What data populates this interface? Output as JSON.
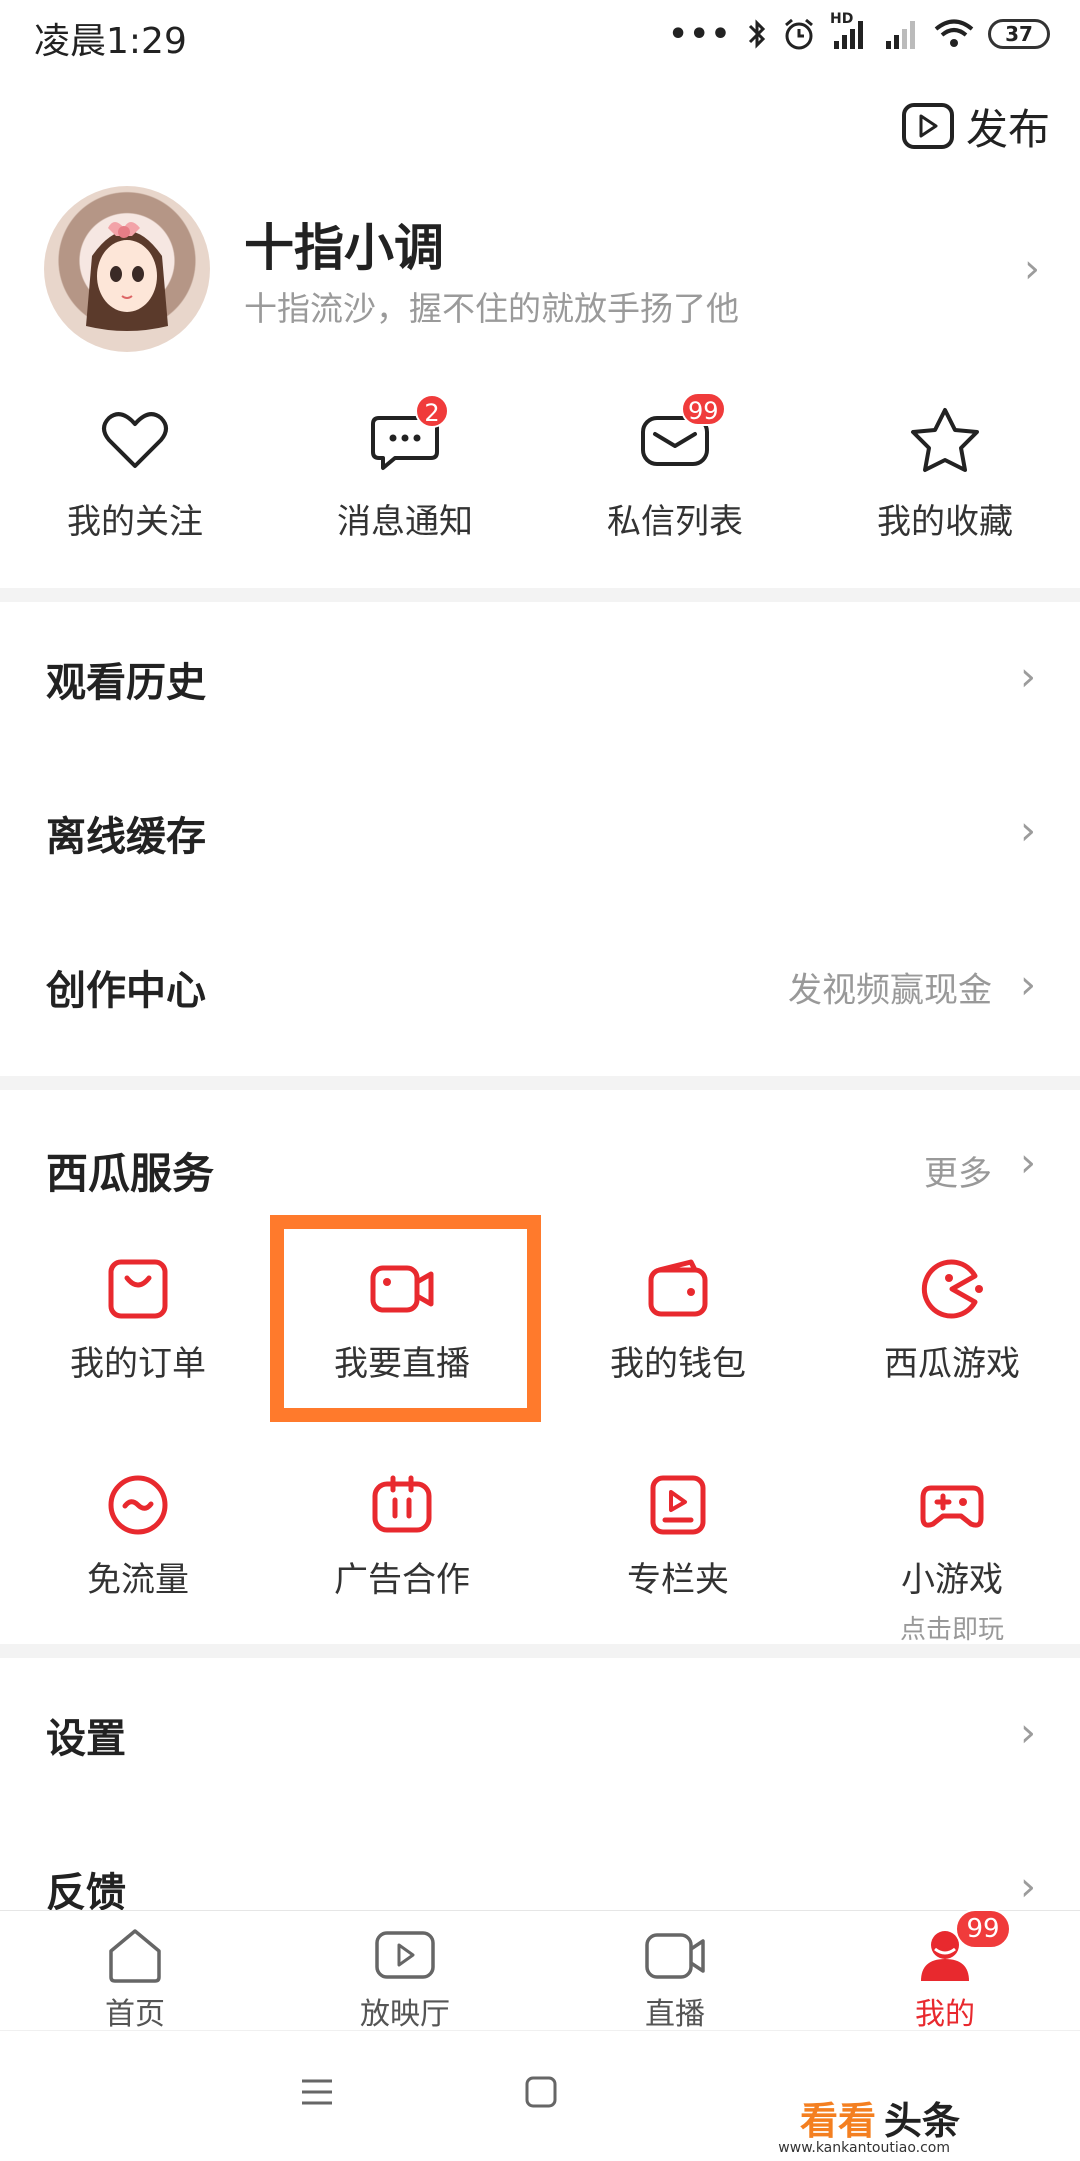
{
  "status_bar": {
    "time": "凌晨1:29",
    "battery": "37",
    "network_label": "HD"
  },
  "publish": {
    "label": "发布"
  },
  "profile": {
    "name": "十指小调",
    "bio": "十指流沙，握不住的就放手扬了他"
  },
  "quick_actions": [
    {
      "label": "我的关注",
      "icon": "heart-icon",
      "badge": ""
    },
    {
      "label": "消息通知",
      "icon": "message-bubble-icon",
      "badge": "2"
    },
    {
      "label": "私信列表",
      "icon": "mail-icon",
      "badge": "99"
    },
    {
      "label": "我的收藏",
      "icon": "star-icon",
      "badge": ""
    }
  ],
  "menu": [
    {
      "label": "观看历史",
      "hint": ""
    },
    {
      "label": "离线缓存",
      "hint": ""
    },
    {
      "label": "创作中心",
      "hint": "发视频赢现金"
    }
  ],
  "services": {
    "title": "西瓜服务",
    "more": "更多",
    "items": [
      {
        "label": "我的订单",
        "icon": "order-bag-icon",
        "sub": ""
      },
      {
        "label": "我要直播",
        "icon": "live-camera-icon",
        "sub": ""
      },
      {
        "label": "我的钱包",
        "icon": "wallet-icon",
        "sub": ""
      },
      {
        "label": "西瓜游戏",
        "icon": "game-pacman-icon",
        "sub": ""
      },
      {
        "label": "免流量",
        "icon": "free-data-icon",
        "sub": ""
      },
      {
        "label": "广告合作",
        "icon": "ad-icon",
        "sub": ""
      },
      {
        "label": "专栏夹",
        "icon": "column-folder-icon",
        "sub": ""
      },
      {
        "label": "小游戏",
        "icon": "gamepad-icon",
        "sub": "点击即玩"
      }
    ]
  },
  "settings_menu": [
    {
      "label": "设置"
    },
    {
      "label": "反馈"
    }
  ],
  "bottom_nav": [
    {
      "label": "首页",
      "icon": "home-icon",
      "badge": ""
    },
    {
      "label": "放映厅",
      "icon": "theater-icon",
      "badge": ""
    },
    {
      "label": "直播",
      "icon": "live-icon",
      "badge": ""
    },
    {
      "label": "我的",
      "icon": "profile-icon",
      "badge": "99",
      "active": true
    }
  ],
  "watermark": {
    "brand": "看看",
    "brand2": "头条",
    "url": "www.kankantoutiao.com"
  },
  "colors": {
    "accent": "#e8292e",
    "highlight": "#ff7a2c",
    "badge": "#f03b3b"
  }
}
